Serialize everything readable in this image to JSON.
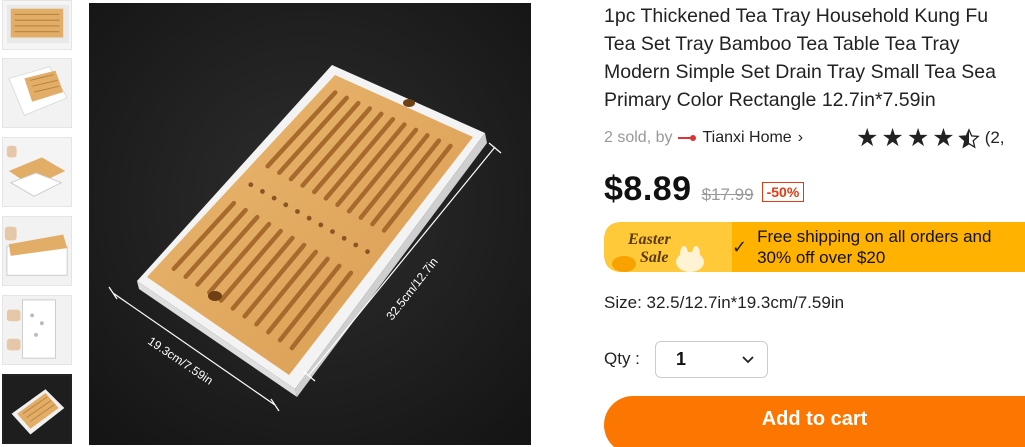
{
  "product": {
    "title": "1pc Thickened Tea Tray Household Kung Fu Tea Set Tray Bamboo Tea Table Tea Tray Modern Simple Set Drain Tray Small Tea Sea Primary Color Rectangle 12.7in*7.59in",
    "sold_text": "2 sold, by",
    "store_name": "Tianxi Home",
    "store_chevron": "›",
    "rating_stars": 4.5,
    "rating_count": "(2,",
    "price": "$8.89",
    "original_price": "$17.99",
    "discount": "-50%",
    "size_label": "Size: 32.5/12.7in*19.3cm/7.59in",
    "qty_label": "Qty :",
    "qty_value": "1",
    "add_to_cart": "Add to cart"
  },
  "promo": {
    "badge_line1": "Easter",
    "badge_line2": "Sale",
    "check": "✓",
    "text": "Free shipping on all orders and 30% off over $20"
  },
  "image_annotations": {
    "length": "32.5cm/12.7in",
    "width": "19.3cm/7.59in"
  },
  "icons": {
    "star": "star-icon",
    "chevron": "chevron-down-icon"
  },
  "colors": {
    "accent": "#fb7701",
    "promo_bg": "#ffb300",
    "discount": "#e03c12",
    "bamboo": "#e7b06a",
    "tray": "#f2f2f2",
    "image_bg": "#1c1c1c"
  }
}
